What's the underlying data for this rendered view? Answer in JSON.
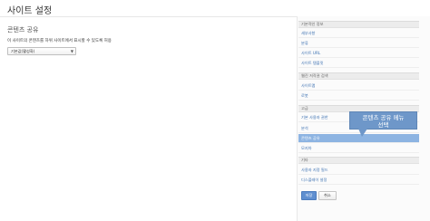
{
  "page": {
    "title": "사이트 설정"
  },
  "content": {
    "section_title": "콘텐츠 공유",
    "description": "이 사이트의 콘텐츠를 하위 사이트에서 표시할 수 있도록 허용",
    "sharing_select": {
      "selected": "기본값(활성화)",
      "arrow": "▼"
    }
  },
  "sidebar": {
    "groups": [
      {
        "label": "기본적인 정보",
        "items": [
          {
            "label": "세부사항"
          },
          {
            "label": "분류"
          },
          {
            "label": "사이트 URL"
          },
          {
            "label": "사이트 템플릿"
          }
        ]
      },
      {
        "label": "웹진 저작권 검색",
        "items": [
          {
            "label": "사이트맵"
          },
          {
            "label": "로봇"
          }
        ]
      },
      {
        "label": "고급",
        "items": [
          {
            "label": "기본 사용자 권한"
          },
          {
            "label": "분석"
          },
          {
            "label": "콘텐츠 공유",
            "selected": true
          },
          {
            "label": "모지아"
          }
        ]
      },
      {
        "label": "기타",
        "items": [
          {
            "label": "사용자 지정 필드"
          },
          {
            "label": "디스플레이 설정"
          }
        ]
      }
    ]
  },
  "callout": {
    "line1": "콘텐츠 공유 메뉴",
    "line2": "선택"
  },
  "buttons": {
    "save": "저장",
    "cancel": "취소"
  },
  "colors": {
    "link": "#3a6fb0",
    "selected_bg": "#8db4e2",
    "callout_bg": "#6e97c9",
    "save_button_bg": "#5f8fd0"
  }
}
